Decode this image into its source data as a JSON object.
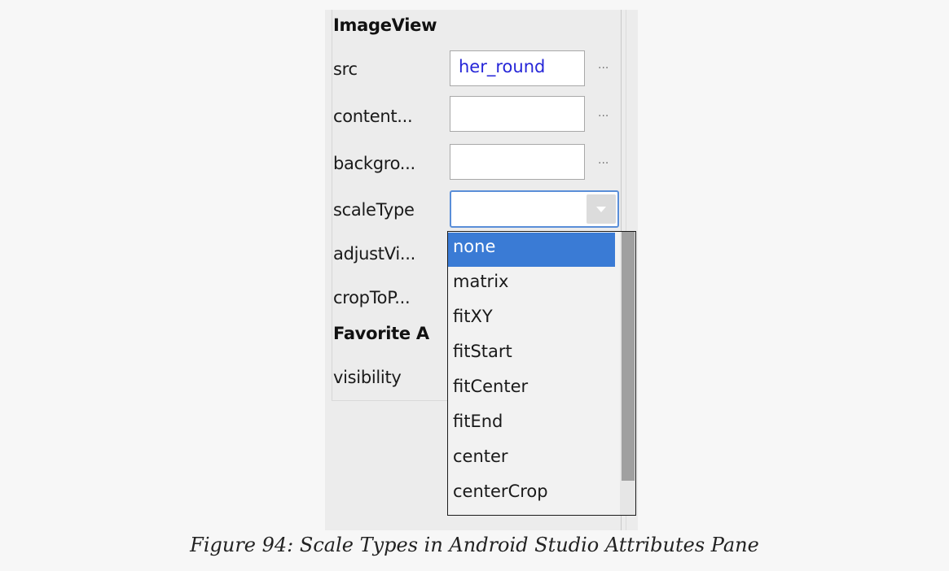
{
  "attributes_pane": {
    "section_imageview": "ImageView",
    "rows": [
      {
        "label": "src",
        "value": "her_round",
        "has_picker": true
      },
      {
        "label": "content...",
        "value": "",
        "has_picker": true
      },
      {
        "label": "backgro...",
        "value": "",
        "has_picker": true
      },
      {
        "label": "scaleType",
        "value": ""
      },
      {
        "label": "adjustVi..."
      },
      {
        "label": "cropToP..."
      }
    ],
    "section_favorite": "Favorite A",
    "visibility_label": "visibility",
    "picker_glyph": "...",
    "combo_icon": "chevron-down-icon"
  },
  "scale_type_dropdown": {
    "options": [
      "none",
      "matrix",
      "fitXY",
      "fitStart",
      "fitCenter",
      "fitEnd",
      "center",
      "centerCrop"
    ],
    "selected": "none"
  },
  "colors": {
    "selection": "#3a7bd5",
    "value_text": "#2626d8",
    "combo_focus": "#5a8ed8"
  },
  "caption": "Figure 94: Scale Types in Android Studio Attributes Pane"
}
